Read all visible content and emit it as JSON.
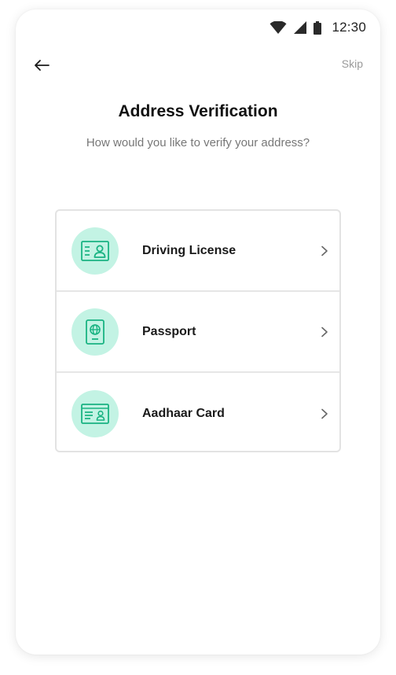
{
  "status_bar": {
    "time": "12:30",
    "icons": [
      "wifi-icon",
      "signal-icon",
      "battery-icon"
    ]
  },
  "nav": {
    "back_icon": "arrow-left-icon",
    "skip_label": "Skip"
  },
  "header": {
    "title": "Address Verification",
    "subtitle": "How would you like to verify your address?"
  },
  "options": [
    {
      "label": "Driving License",
      "icon": "id-card-icon"
    },
    {
      "label": "Passport",
      "icon": "passport-icon"
    },
    {
      "label": "Aadhaar Card",
      "icon": "aadhaar-card-icon"
    }
  ],
  "colors": {
    "icon_bg": "#c3f3e4",
    "icon_stroke": "#19b382",
    "skip_text": "#9a9a9a"
  }
}
